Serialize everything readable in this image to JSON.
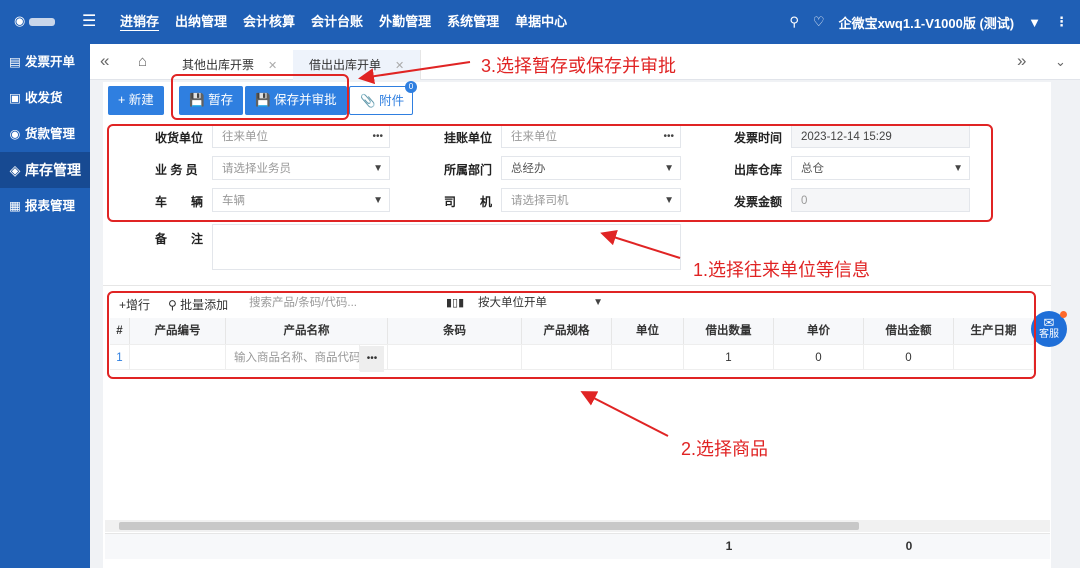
{
  "topbar": {
    "menu": [
      "进销存",
      "出纳管理",
      "会计核算",
      "会计台账",
      "外勤管理",
      "系统管理",
      "单据中心"
    ],
    "company": "企微宝xwq1.1-V1000版 (测试)"
  },
  "sidebar": {
    "items": [
      {
        "label": "发票开单",
        "icon": "invoice-icon"
      },
      {
        "label": "收发货",
        "icon": "truck-icon"
      },
      {
        "label": "货款管理",
        "icon": "money-icon"
      },
      {
        "label": "库存管理",
        "icon": "layers-icon"
      },
      {
        "label": "报表管理",
        "icon": "report-icon"
      }
    ]
  },
  "tabs": [
    {
      "label": "其他出库开票"
    },
    {
      "label": "借出出库开单"
    }
  ],
  "toolbar": {
    "new": "+ 新建",
    "draft": "暂存",
    "save_approve": "保存并审批",
    "attach": "附件",
    "attach_count": "0"
  },
  "form": {
    "receiver": {
      "label": "收货单位",
      "placeholder": "往来单位"
    },
    "account": {
      "label": "挂账单位",
      "placeholder": "往来单位"
    },
    "invoice_time": {
      "label": "发票时间",
      "value": "2023-12-14 15:29"
    },
    "salesman": {
      "label": "业 务 员",
      "placeholder": "请选择业务员"
    },
    "dept": {
      "label": "所属部门",
      "value": "总经办"
    },
    "warehouse": {
      "label": "出库仓库",
      "value": "总仓"
    },
    "vehicle": {
      "label": "车　　辆",
      "placeholder": "车辆"
    },
    "driver": {
      "label": "司　　机",
      "placeholder": "请选择司机"
    },
    "amount": {
      "label": "发票金额",
      "value": "0"
    },
    "remark": {
      "label": "备　　注"
    }
  },
  "grid": {
    "add_row": "+增行",
    "batch_add": "批量添加",
    "search_placeholder": "搜索产品/条码/代码...",
    "mode": "按大单位开单",
    "columns": [
      "#",
      "产品编号",
      "产品名称",
      "条码",
      "产品规格",
      "单位",
      "借出数量",
      "单价",
      "借出金额",
      "生产日期"
    ],
    "row": {
      "index": "1",
      "name_placeholder": "输入商品名称、商品代码、",
      "qty": "1",
      "price": "0",
      "amount": "0"
    },
    "footer": {
      "qty_total": "1",
      "amount_total": "0"
    }
  },
  "annotations": {
    "step1": "1.选择往来单位等信息",
    "step2": "2.选择商品",
    "step3": "3.选择暂存或保存并审批"
  },
  "kefu": "客服",
  "colors": {
    "brand": "#1f5fb5",
    "accent": "#2f7fe0",
    "annotation": "#e02424"
  }
}
